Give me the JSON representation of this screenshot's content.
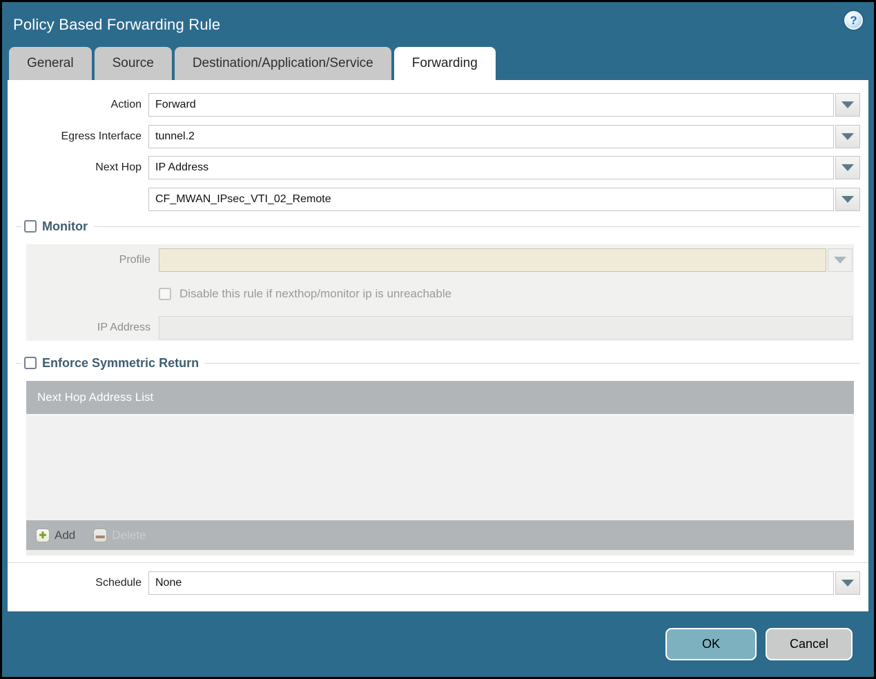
{
  "window": {
    "title": "Policy Based Forwarding Rule"
  },
  "tabs": [
    {
      "label": "General",
      "active": false
    },
    {
      "label": "Source",
      "active": false
    },
    {
      "label": "Destination/Application/Service",
      "active": false
    },
    {
      "label": "Forwarding",
      "active": true
    }
  ],
  "form": {
    "action": {
      "label": "Action",
      "value": "Forward"
    },
    "egress_interface": {
      "label": "Egress Interface",
      "value": "tunnel.2"
    },
    "next_hop": {
      "label": "Next Hop",
      "value": "IP Address"
    },
    "next_hop_address": {
      "value": "CF_MWAN_IPsec_VTI_02_Remote"
    },
    "schedule": {
      "label": "Schedule",
      "value": "None"
    }
  },
  "monitor": {
    "title": "Monitor",
    "checked": false,
    "profile": {
      "label": "Profile",
      "value": ""
    },
    "disable_rule": {
      "label": "Disable this rule if nexthop/monitor ip is unreachable",
      "checked": false
    },
    "ip_address": {
      "label": "IP Address",
      "value": ""
    }
  },
  "symmetric_return": {
    "title": "Enforce Symmetric Return",
    "checked": false,
    "list_header": "Next Hop Address List",
    "rows": [],
    "add_label": "Add",
    "delete_label": "Delete"
  },
  "footer": {
    "ok_label": "OK",
    "cancel_label": "Cancel"
  },
  "colors": {
    "titlebar": "#2d6b8c",
    "ok_button": "#7db1c0",
    "cancel_button": "#c9cbcb",
    "table_header": "#b1b5b8",
    "disabled_field": "#f0ebd9",
    "section_title": "#3f5e70"
  }
}
